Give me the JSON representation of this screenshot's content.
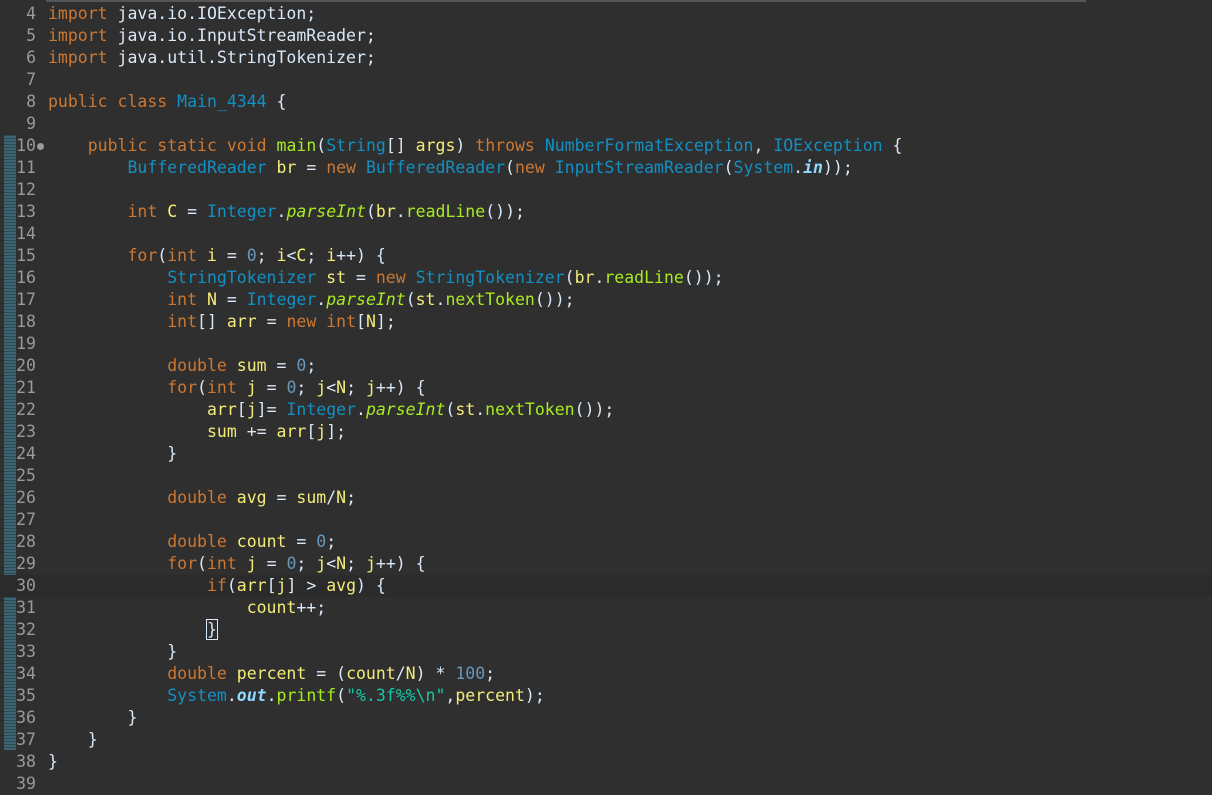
{
  "editor": {
    "lines": [
      {
        "n": "4",
        "code": "import java.io.IOException;"
      },
      {
        "n": "5",
        "code": "import java.io.InputStreamReader;"
      },
      {
        "n": "6",
        "code": "import java.util.StringTokenizer;"
      },
      {
        "n": "7",
        "code": ""
      },
      {
        "n": "8",
        "code": "public class Main_4344 {"
      },
      {
        "n": "9",
        "code": ""
      },
      {
        "n": "10",
        "code": "    public static void main(String[] args) throws NumberFormatException, IOException {"
      },
      {
        "n": "11",
        "code": "        BufferedReader br = new BufferedReader(new InputStreamReader(System.in));"
      },
      {
        "n": "12",
        "code": ""
      },
      {
        "n": "13",
        "code": "        int C = Integer.parseInt(br.readLine());"
      },
      {
        "n": "14",
        "code": ""
      },
      {
        "n": "15",
        "code": "        for(int i = 0; i<C; i++) {"
      },
      {
        "n": "16",
        "code": "            StringTokenizer st = new StringTokenizer(br.readLine());"
      },
      {
        "n": "17",
        "code": "            int N = Integer.parseInt(st.nextToken());"
      },
      {
        "n": "18",
        "code": "            int[] arr = new int[N];"
      },
      {
        "n": "19",
        "code": ""
      },
      {
        "n": "20",
        "code": "            double sum = 0;"
      },
      {
        "n": "21",
        "code": "            for(int j = 0; j<N; j++) {"
      },
      {
        "n": "22",
        "code": "                arr[j]= Integer.parseInt(st.nextToken());"
      },
      {
        "n": "23",
        "code": "                sum += arr[j];"
      },
      {
        "n": "24",
        "code": "            }"
      },
      {
        "n": "25",
        "code": ""
      },
      {
        "n": "26",
        "code": "            double avg = sum/N;"
      },
      {
        "n": "27",
        "code": ""
      },
      {
        "n": "28",
        "code": "            double count = 0;"
      },
      {
        "n": "29",
        "code": "            for(int j = 0; j<N; j++) {"
      },
      {
        "n": "30",
        "code": "                if(arr[j] > avg) {"
      },
      {
        "n": "31",
        "code": "                    count++;"
      },
      {
        "n": "32",
        "code": "                }"
      },
      {
        "n": "33",
        "code": "            }"
      },
      {
        "n": "34",
        "code": "            double percent = (count/N) * 100;"
      },
      {
        "n": "35",
        "code": "            System.out.printf(\"%.3f%%\\n\",percent);"
      },
      {
        "n": "36",
        "code": "        }"
      },
      {
        "n": "37",
        "code": "    }"
      },
      {
        "n": "38",
        "code": "}"
      },
      {
        "n": "39",
        "code": ""
      }
    ],
    "current_line": "30",
    "breakpoint_line": "10",
    "colors": {
      "background": "#2f2f2f",
      "keyword": "#cc7832",
      "type": "#1290c3",
      "method": "#a7ec21",
      "string": "#17c6a3",
      "number": "#6897bb",
      "variable": "#f3ec79",
      "text": "#d9e8f7",
      "line_number": "#9a9a9a"
    }
  }
}
